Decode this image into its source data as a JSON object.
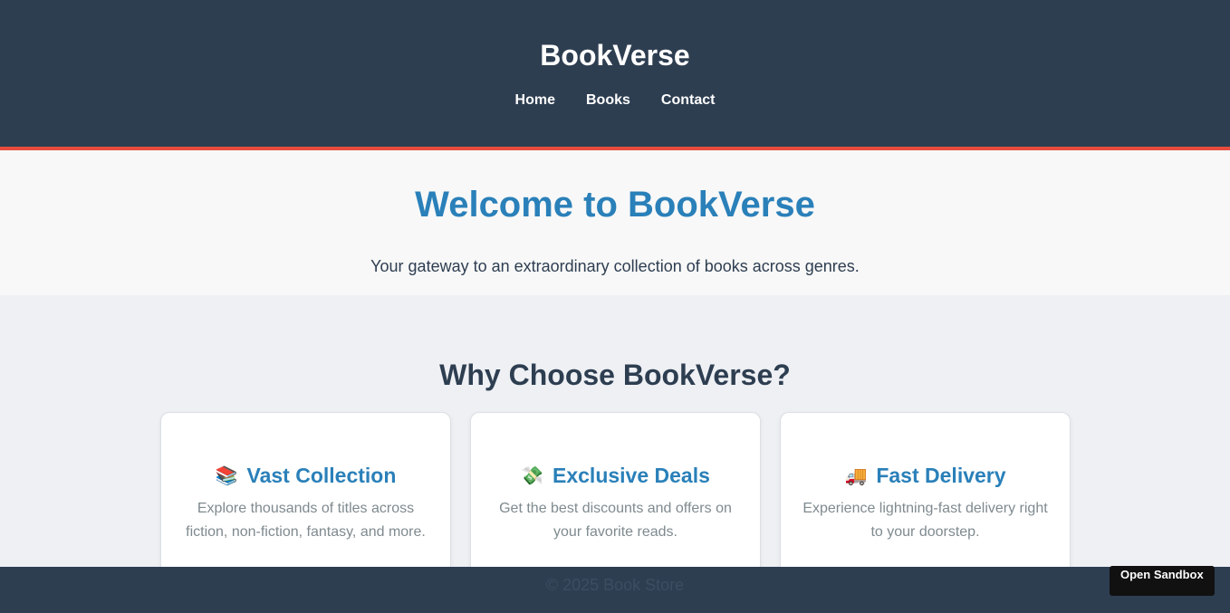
{
  "header": {
    "title": "BookVerse",
    "nav": [
      {
        "label": "Home"
      },
      {
        "label": "Books"
      },
      {
        "label": "Contact"
      }
    ]
  },
  "hero": {
    "title": "Welcome to BookVerse",
    "subtitle": "Your gateway to an extraordinary collection of books across genres."
  },
  "features": {
    "title": "Why Choose BookVerse?",
    "cards": [
      {
        "icon": "📚",
        "icon_name": "books-icon",
        "title": "Vast Collection",
        "desc": "Explore thousands of titles across fiction, non-fiction, fantasy, and more."
      },
      {
        "icon": "💸",
        "icon_name": "money-with-wings-icon",
        "title": "Exclusive Deals",
        "desc": "Get the best discounts and offers on your favorite reads."
      },
      {
        "icon": "🚚",
        "icon_name": "delivery-truck-icon",
        "title": "Fast Delivery",
        "desc": "Experience lightning-fast delivery right to your doorstep."
      }
    ]
  },
  "footer": {
    "text": "© 2025 Book Store"
  },
  "sandbox": {
    "label": "Open Sandbox"
  },
  "colors": {
    "header_bg": "#2e3e51",
    "accent_red": "#e74c3c",
    "accent_blue": "#2a80b9"
  }
}
